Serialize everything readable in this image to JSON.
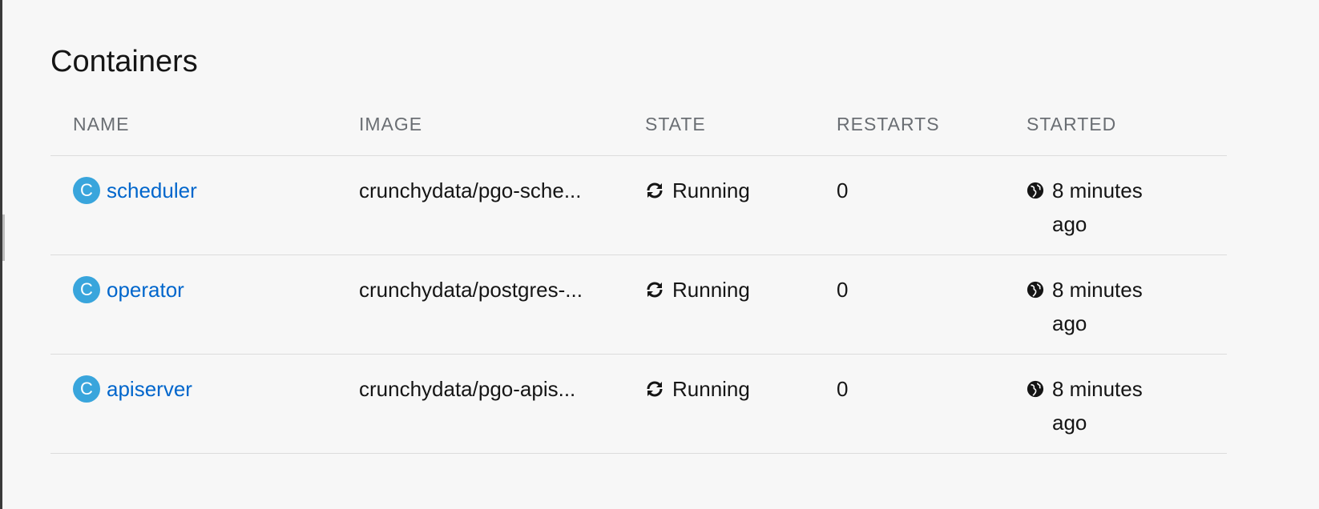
{
  "section": {
    "title": "Containers"
  },
  "columns": {
    "name": "NAME",
    "image": "IMAGE",
    "state": "STATE",
    "restarts": "RESTARTS",
    "started": "STARTED"
  },
  "rows": [
    {
      "badge": "C",
      "name": "scheduler",
      "image": "crunchydata/pgo-sche...",
      "state": "Running",
      "restarts": "0",
      "started": "8 minutes ago"
    },
    {
      "badge": "C",
      "name": "operator",
      "image": "crunchydata/postgres-...",
      "state": "Running",
      "restarts": "0",
      "started": "8 minutes ago"
    },
    {
      "badge": "C",
      "name": "apiserver",
      "image": "crunchydata/pgo-apis...",
      "state": "Running",
      "restarts": "0",
      "started": "8 minutes ago"
    }
  ],
  "icons": {
    "state": "sync-icon",
    "started": "globe-icon"
  },
  "colors": {
    "badge": "#39a5dc",
    "link": "#0066cc",
    "header_text": "#6a6e73"
  }
}
